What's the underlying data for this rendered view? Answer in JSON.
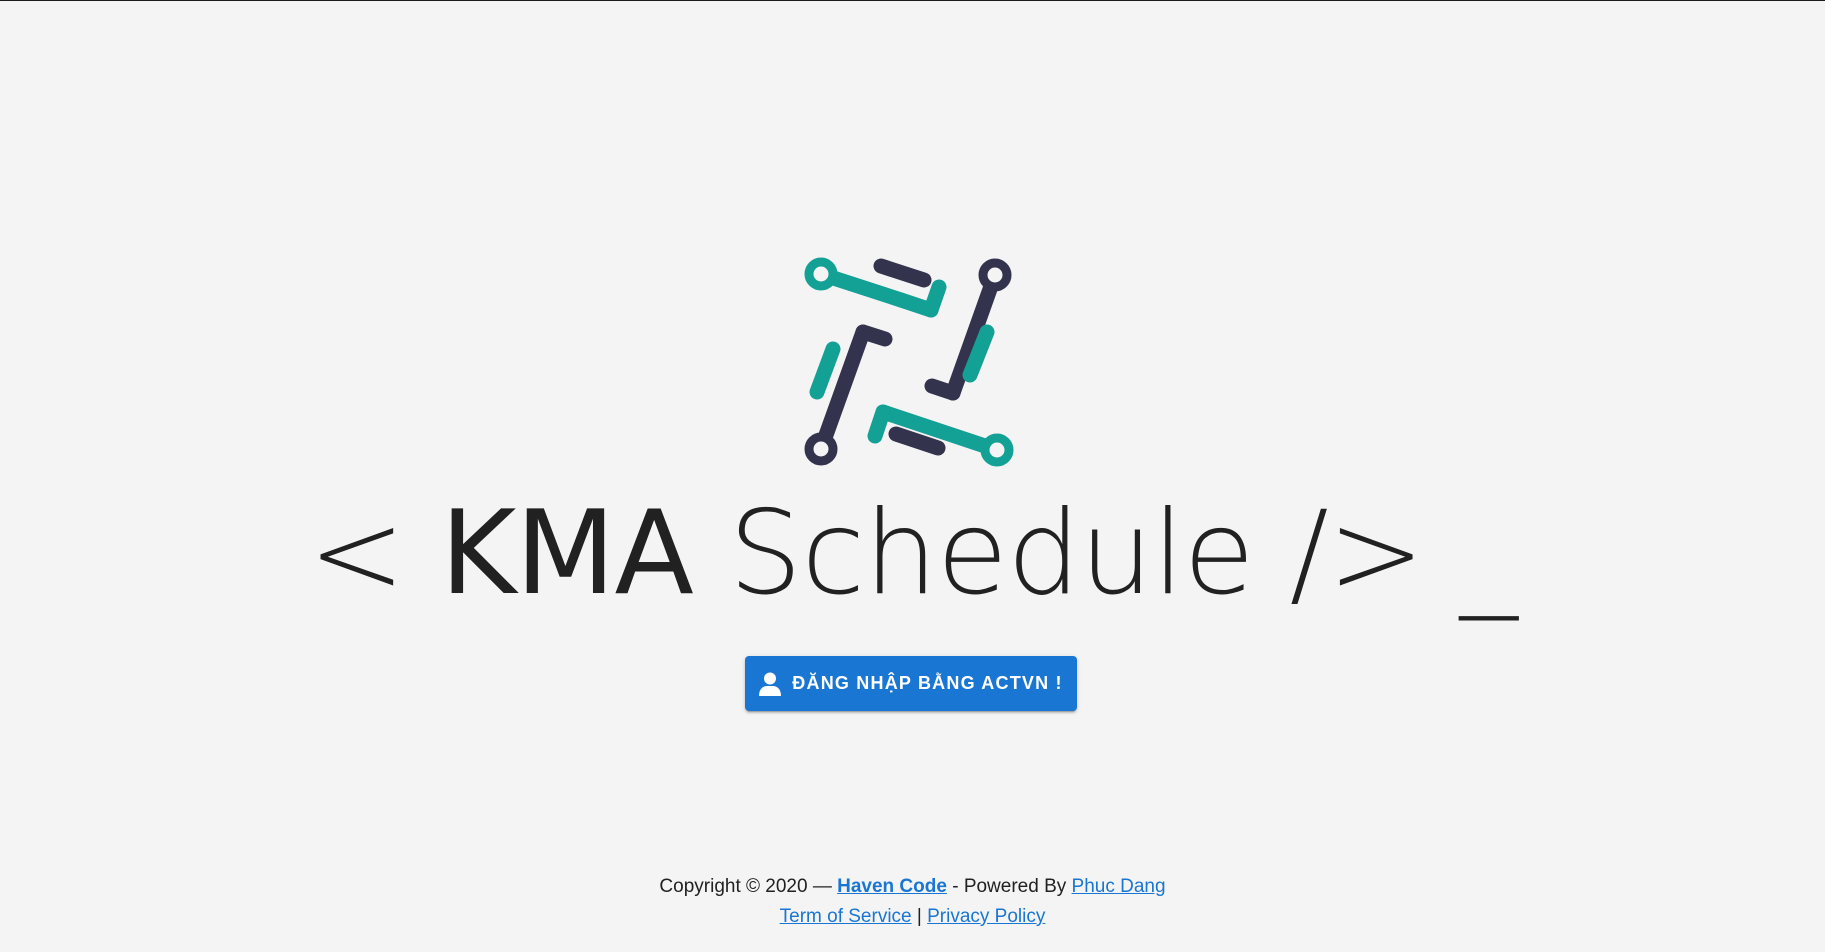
{
  "hero": {
    "logo_icon": "kma-circuit-logo-icon",
    "title_prefix": "< ",
    "title_strong": "KMA",
    "title_rest": " Schedule /> _"
  },
  "login": {
    "icon": "user-icon",
    "label": "ĐĂNG NHẬP BẰNG ACTVN !"
  },
  "footer": {
    "copyright": "Copyright © 2020 — ",
    "haven_code": "Haven Code",
    "powered_by": " - Powered By ",
    "author": "Phuc Dang",
    "terms": "Term of Service",
    "separator": " | ",
    "privacy": "Privacy Policy"
  },
  "colors": {
    "background": "#f4f4f4",
    "teal": "#14a195",
    "navy": "#33334d",
    "primary": "#1976d2"
  }
}
